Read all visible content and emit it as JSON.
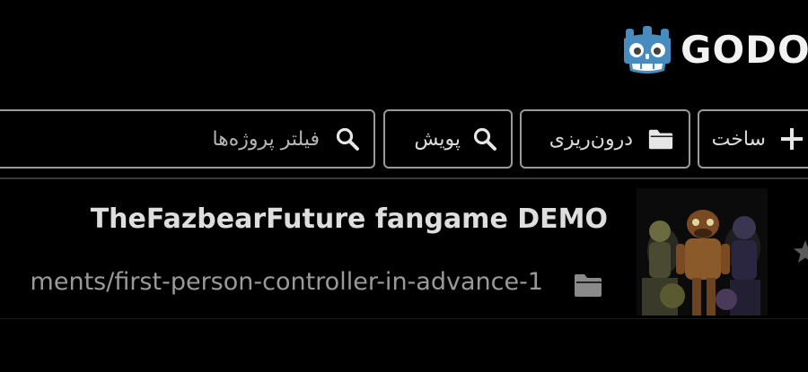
{
  "header": {
    "logo_text": "GODOT",
    "logo_icon": "godot-robot-icon"
  },
  "toolbar": {
    "filter_placeholder": "فیلتر پروژه‌ها",
    "filter_icon": "search-icon",
    "scan_label": "پویش",
    "scan_icon": "search-icon",
    "import_label": "درون‌ریزی",
    "import_icon": "folder-icon",
    "create_label": "ساخت",
    "create_icon": "plus-icon"
  },
  "projects": [
    {
      "title": "TheFazbearFuture fangame DEMO",
      "path": "ments/first-person-controller-in-advance-1",
      "thumbnail": "project-thumbnail-image",
      "favorite_icon": "star-icon",
      "folder_icon": "folder-icon"
    }
  ],
  "colors": {
    "background": "#000000",
    "border": "#9a9a9a",
    "text": "#dcdcdc",
    "path_text": "#9a9a9a",
    "godot_blue": "#478cbf"
  }
}
